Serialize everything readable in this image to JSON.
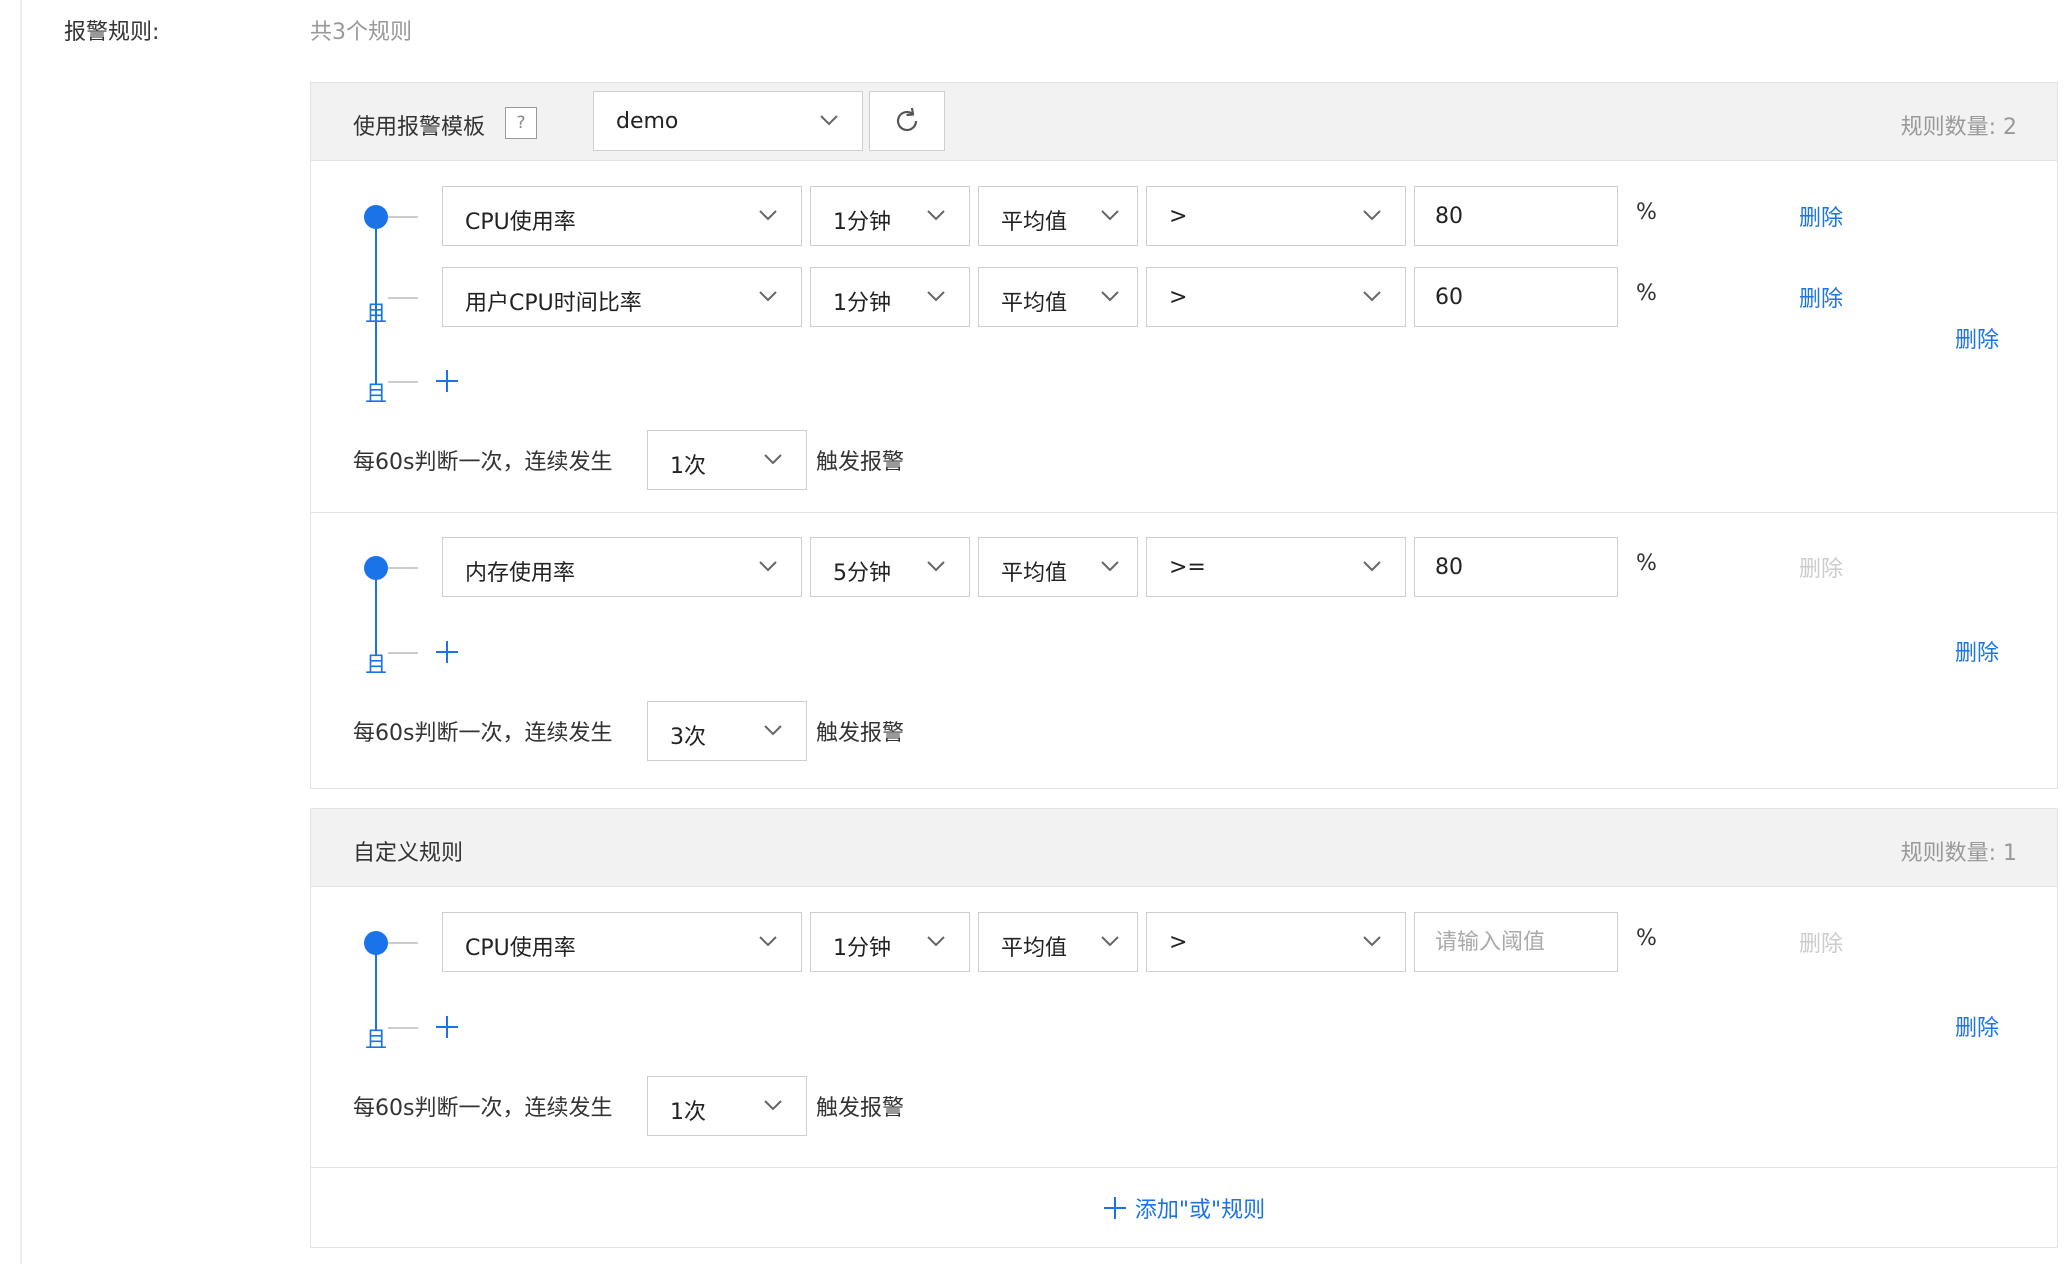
{
  "field_label": "报警规则:",
  "total_rules": "共3个规则",
  "template_panel": {
    "title": "使用报警模板",
    "help": "?",
    "template_value": "demo",
    "count_text": "规则数量: 2",
    "groups": [
      {
        "conditions": [
          {
            "metric": "CPU使用率",
            "period": "1分钟",
            "stat": "平均值",
            "op": ">",
            "threshold": "80",
            "unit": "%",
            "delete": "删除",
            "delete_enabled": true
          },
          {
            "metric": "用户CPU时间比率",
            "period": "1分钟",
            "stat": "平均值",
            "op": ">",
            "threshold": "60",
            "unit": "%",
            "delete": "删除",
            "delete_enabled": true
          }
        ],
        "and_label": "且",
        "freq_prefix": "每60s判断一次，连续发生",
        "times": "1次",
        "freq_suffix": "触发报警",
        "group_delete": "删除"
      },
      {
        "conditions": [
          {
            "metric": "内存使用率",
            "period": "5分钟",
            "stat": "平均值",
            "op": ">=",
            "threshold": "80",
            "unit": "%",
            "delete": "删除",
            "delete_enabled": false
          }
        ],
        "and_label": "且",
        "freq_prefix": "每60s判断一次，连续发生",
        "times": "3次",
        "freq_suffix": "触发报警",
        "group_delete": "删除"
      }
    ]
  },
  "custom_panel": {
    "title": "自定义规则",
    "count_text": "规则数量: 1",
    "groups": [
      {
        "conditions": [
          {
            "metric": "CPU使用率",
            "period": "1分钟",
            "stat": "平均值",
            "op": ">",
            "threshold": "",
            "threshold_placeholder": "请输入阈值",
            "unit": "%",
            "delete": "删除",
            "delete_enabled": false
          }
        ],
        "and_label": "且",
        "freq_prefix": "每60s判断一次，连续发生",
        "times": "1次",
        "freq_suffix": "触发报警",
        "group_delete": "删除"
      }
    ],
    "add_or_label": "添加\"或\"规则"
  },
  "colors": {
    "accent": "#1a73e8",
    "disabled": "#cccccc",
    "muted": "#999999",
    "header_bg": "#f2f2f2"
  }
}
